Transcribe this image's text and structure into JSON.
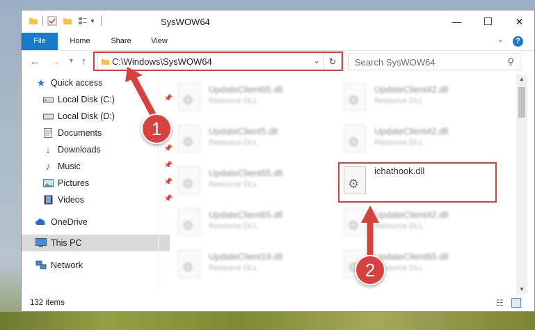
{
  "window": {
    "title": "SysWOW64",
    "controls": {
      "minimize": "—",
      "maximize": "☐",
      "close": "✕"
    }
  },
  "ribbon": {
    "tabs": [
      "File",
      "Home",
      "Share",
      "View"
    ],
    "help": "?"
  },
  "nav": {
    "path": "C:\\Windows\\SysWOW64",
    "search_placeholder": "Search SysWOW64"
  },
  "sidebar": {
    "items": [
      {
        "label": "Quick access",
        "icon": "star-icon"
      },
      {
        "label": "Local Disk (C:)",
        "icon": "drive-icon"
      },
      {
        "label": "Local Disk (D:)",
        "icon": "drive-icon"
      },
      {
        "label": "Documents",
        "icon": "documents-icon"
      },
      {
        "label": "Downloads",
        "icon": "download-icon"
      },
      {
        "label": "Music",
        "icon": "music-icon"
      },
      {
        "label": "Pictures",
        "icon": "pictures-icon"
      },
      {
        "label": "Videos",
        "icon": "videos-icon"
      },
      {
        "label": "OneDrive",
        "icon": "cloud-icon"
      },
      {
        "label": "This PC",
        "icon": "computer-icon"
      },
      {
        "label": "Network",
        "icon": "network-icon"
      }
    ]
  },
  "files": {
    "left": [
      {
        "name": "UpdateClient65.dll",
        "type": "Resource DLL"
      },
      {
        "name": "UpdateClient5.dll",
        "type": "Resource DLL"
      },
      {
        "name": "UpdateClient65.dll",
        "type": "Resource DLL"
      },
      {
        "name": "UpdateClient65.dll",
        "type": "Resource DLL"
      },
      {
        "name": "UpdateClient19.dll",
        "type": "Resource DLL"
      }
    ],
    "right": [
      {
        "name": "UpdateClient42.dll",
        "type": "Resource DLL"
      },
      {
        "name": "UpdateClient42.dll",
        "type": "Resource DLL"
      },
      {
        "name": "ichathook.dll",
        "type": ""
      },
      {
        "name": "UpdateClient42.dll",
        "type": "Resource DLL"
      },
      {
        "name": "UpdateClient65.dll",
        "type": "Resource DLL"
      }
    ]
  },
  "status": {
    "count": "132 items"
  },
  "annotations": {
    "step1": "1",
    "step2": "2",
    "color": "#d7423f"
  }
}
